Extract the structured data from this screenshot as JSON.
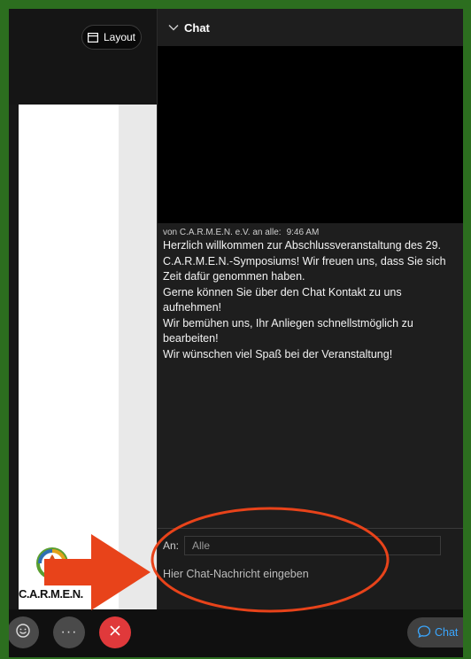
{
  "toolbar": {
    "layout_label": "Layout"
  },
  "chat": {
    "header_title": "Chat",
    "message": {
      "meta": "von C.A.R.M.E.N. e.V. an alle:",
      "time": "9:46 AM",
      "lines": [
        "Herzlich willkommen zur Abschlussveranstaltung des 29. C.A.R.M.E.N.-Symposiums! Wir freuen uns, dass Sie sich Zeit dafür genommen haben.",
        "Gerne können Sie über den Chat Kontakt zu uns aufnehmen!",
        "Wir bemühen uns, Ihr Anliegen schnellstmöglich zu bearbeiten!",
        "Wir wünschen viel Spaß bei der Veranstaltung!"
      ]
    },
    "to_label": "An:",
    "to_value": "Alle",
    "input_placeholder": "Hier Chat-Nachricht eingeben"
  },
  "slide": {
    "logo_text": "C.A.R.M.E.N."
  },
  "controls": {
    "more_label": "···",
    "chat_toggle_label": "Chat"
  },
  "colors": {
    "frame_border": "#2c6e1f",
    "leave_red": "#e0393b",
    "annotation": "#e8431a",
    "chat_accent": "#3aa7ff"
  },
  "icons": [
    "layout-icon",
    "chevron-down-icon",
    "reaction-icon",
    "more-icon",
    "close-icon",
    "chat-bubble-icon",
    "arrow-annotation",
    "ellipse-annotation"
  ]
}
